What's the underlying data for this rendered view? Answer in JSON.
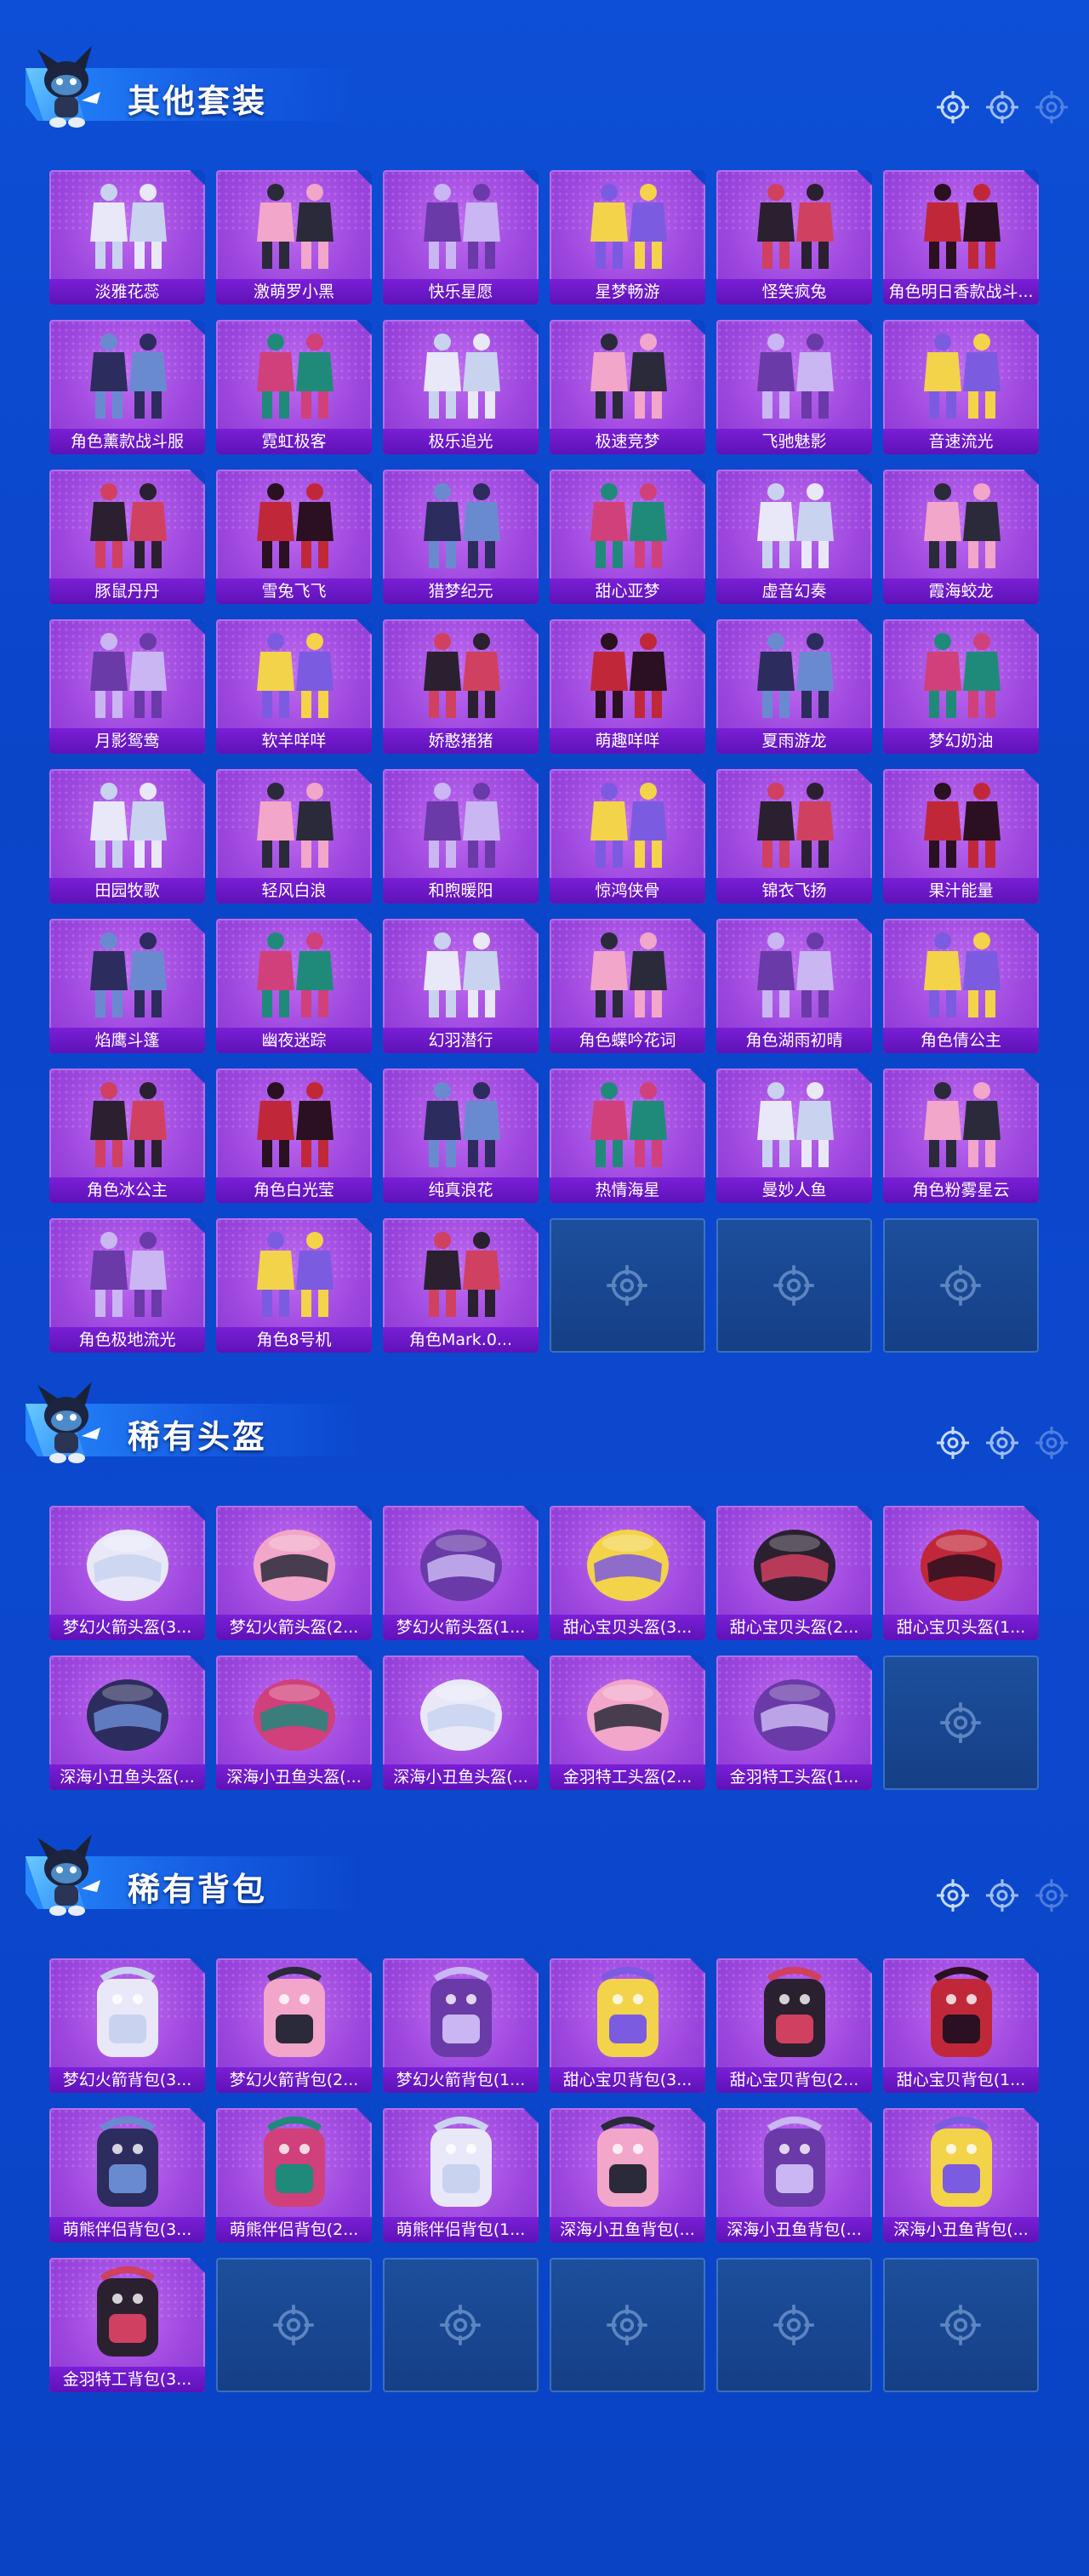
{
  "sections": [
    {
      "title": "其他套装",
      "items": [
        "淡雅花蕊",
        "激萌罗小黑",
        "快乐星愿",
        "星梦畅游",
        "怪笑疯兔",
        "角色明日香款战斗...",
        "角色薰款战斗服",
        "霓虹极客",
        "极乐追光",
        "极速竞梦",
        "飞驰魅影",
        "音速流光",
        "豚鼠丹丹",
        "雪兔飞飞",
        "猎梦纪元",
        "甜心亚梦",
        "虚音幻奏",
        "霞海蛟龙",
        "月影鸳鸯",
        "软羊咩咩",
        "娇憨猪猪",
        "萌趣咩咩",
        "夏雨游龙",
        "梦幻奶油",
        "田园牧歌",
        "轻风白浪",
        "和煦暖阳",
        "惊鸿侠骨",
        "锦衣飞扬",
        "果汁能量",
        "焰鹰斗篷",
        "幽夜迷踪",
        "幻羽潜行",
        "角色蝶吟花词",
        "角色湖雨初晴",
        "角色倩公主",
        "角色冰公主",
        "角色白光莹",
        "纯真浪花",
        "热情海星",
        "曼妙人鱼",
        "角色粉雾星云",
        "角色极地流光",
        "角色8号机",
        "角色Mark.0..."
      ],
      "empty_slots": 3
    },
    {
      "title": "稀有头盔",
      "items": [
        "梦幻火箭头盔(3...",
        "梦幻火箭头盔(2...",
        "梦幻火箭头盔(1...",
        "甜心宝贝头盔(3...",
        "甜心宝贝头盔(2...",
        "甜心宝贝头盔(1...",
        "深海小丑鱼头盔(...",
        "深海小丑鱼头盔(...",
        "深海小丑鱼头盔(...",
        "金羽特工头盔(2...",
        "金羽特工头盔(1..."
      ],
      "empty_slots": 1
    },
    {
      "title": "稀有背包",
      "items": [
        "梦幻火箭背包(3...",
        "梦幻火箭背包(2...",
        "梦幻火箭背包(1...",
        "甜心宝贝背包(3...",
        "甜心宝贝背包(2...",
        "甜心宝贝背包(1...",
        "萌熊伴侣背包(3...",
        "萌熊伴侣背包(2...",
        "萌熊伴侣背包(1...",
        "深海小丑鱼背包(...",
        "深海小丑鱼背包(...",
        "深海小丑鱼背包(...",
        "金羽特工背包(3..."
      ],
      "empty_slots": 5
    }
  ],
  "colors": {
    "background": "#0b49cf",
    "tile_purple": "#9c46de",
    "label_purple": "#6a18c8",
    "empty_tile": "#1a4a94"
  },
  "icons": [
    "mascot-icon",
    "crosshair-icon"
  ]
}
